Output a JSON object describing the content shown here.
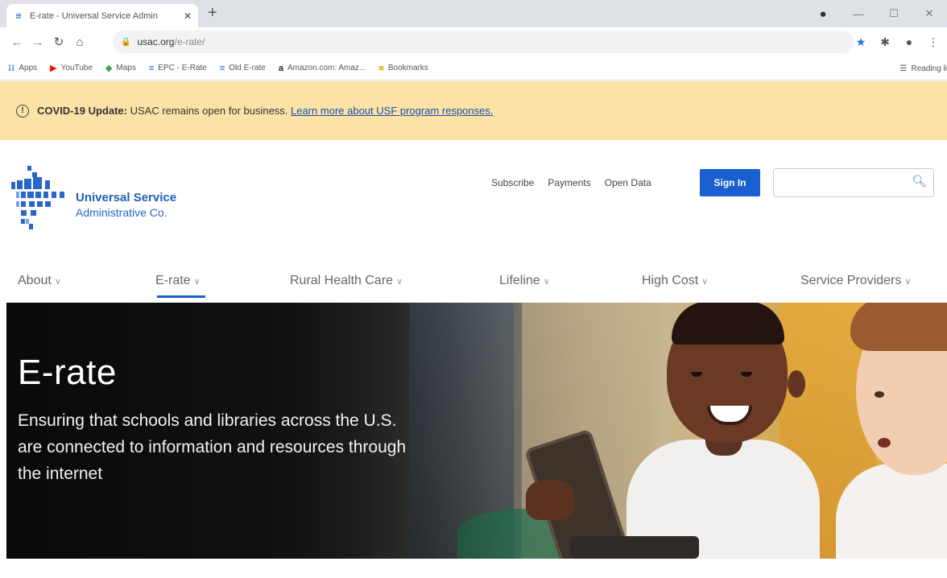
{
  "browser": {
    "tab_title": "E-rate - Universal Service Admin",
    "tab_close": "✕",
    "new_tab": "+",
    "url_host": "usac.org",
    "url_path": "/e-rate/",
    "bookmarks": [
      {
        "label": "Apps",
        "icon": "apps-grid-icon",
        "color": "#4285f4"
      },
      {
        "label": "YouTube",
        "icon": "youtube-icon",
        "color": "#ff0000"
      },
      {
        "label": "Maps",
        "icon": "maps-icon",
        "color": "#34a853"
      },
      {
        "label": "EPC - E-Rate",
        "icon": "usac-icon",
        "color": "#1a5fc7"
      },
      {
        "label": "Old E-rate",
        "icon": "usac-icon",
        "color": "#1a5fc7"
      },
      {
        "label": "Amazon.com: Amaz...",
        "icon": "amazon-icon",
        "color": "#222222"
      },
      {
        "label": "Bookmarks",
        "icon": "folder-icon",
        "color": "#f2c12e"
      }
    ],
    "reading_list": "Reading li"
  },
  "alert": {
    "heading": "COVID-19 Update:",
    "text": "USAC remains open for business.",
    "link": "Learn more about USF program responses."
  },
  "logo": {
    "line1": "Universal Service",
    "line2": "Administrative Co."
  },
  "utility_nav": [
    "Subscribe",
    "Payments",
    "Open Data"
  ],
  "signin_label": "Sign In",
  "search": {
    "placeholder": ""
  },
  "main_nav": [
    {
      "label": "About",
      "active": false
    },
    {
      "label": "E-rate",
      "active": true
    },
    {
      "label": "Rural Health Care",
      "active": false
    },
    {
      "label": "Lifeline",
      "active": false
    },
    {
      "label": "High Cost",
      "active": false
    },
    {
      "label": "Service Providers",
      "active": false
    }
  ],
  "hero": {
    "title": "E-rate",
    "subtitle": "Ensuring that schools and libraries across the U.S. are connected to information and resources through the internet"
  },
  "colors": {
    "brand_blue": "#1a5fd0",
    "alert_bg": "#fbe3a8"
  }
}
